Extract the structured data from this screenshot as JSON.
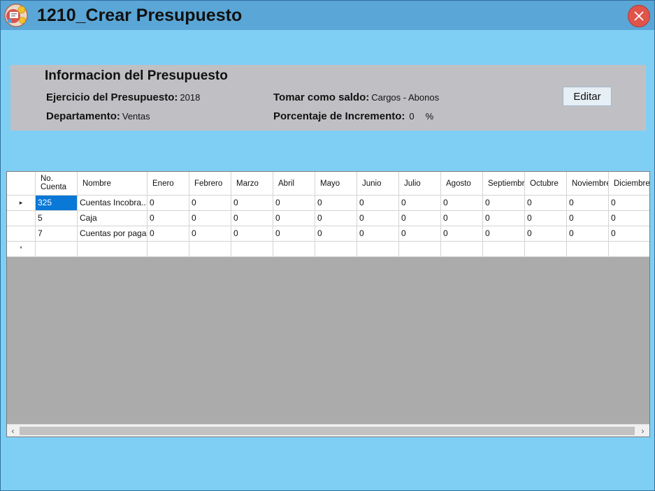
{
  "window": {
    "title": "1210_Crear Presupuesto",
    "close_icon": "close-icon",
    "app_icon": "budget-app-icon"
  },
  "info": {
    "heading": "Informacion del Presupuesto",
    "ejercicio_label": "Ejercicio del Presupuesto:",
    "ejercicio_value": "2018",
    "departamento_label": "Departamento:",
    "departamento_value": "Ventas",
    "saldo_label": "Tomar como saldo:",
    "saldo_value": "Cargos - Abonos",
    "incremento_label": "Porcentaje de Incremento:",
    "incremento_value": "0",
    "incremento_unit": "%",
    "edit_label": "Editar"
  },
  "grid": {
    "columns": [
      "No. Cuenta",
      "Nombre",
      "Enero",
      "Febrero",
      "Marzo",
      "Abril",
      "Mayo",
      "Junio",
      "Julio",
      "Agosto",
      "Septiembre",
      "Octubre",
      "Noviembre",
      "Diciembre"
    ],
    "rows": [
      [
        "325",
        "Cuentas Incobra...",
        "0",
        "0",
        "0",
        "0",
        "0",
        "0",
        "0",
        "0",
        "0",
        "0",
        "0",
        "0"
      ],
      [
        "5",
        "Caja",
        "0",
        "0",
        "0",
        "0",
        "0",
        "0",
        "0",
        "0",
        "0",
        "0",
        "0",
        "0"
      ],
      [
        "7",
        "Cuentas por pagar",
        "0",
        "0",
        "0",
        "0",
        "0",
        "0",
        "0",
        "0",
        "0",
        "0",
        "0",
        "0"
      ]
    ],
    "current_row_marker": "▸",
    "new_row_marker": "*",
    "scroll_left": "‹",
    "scroll_right": "›"
  },
  "colors": {
    "background": "#7fcff5",
    "titlebar": "#5aa6d6",
    "panel": "#c0c0c4",
    "selection": "#0a78d7",
    "close": "#e0544a"
  }
}
